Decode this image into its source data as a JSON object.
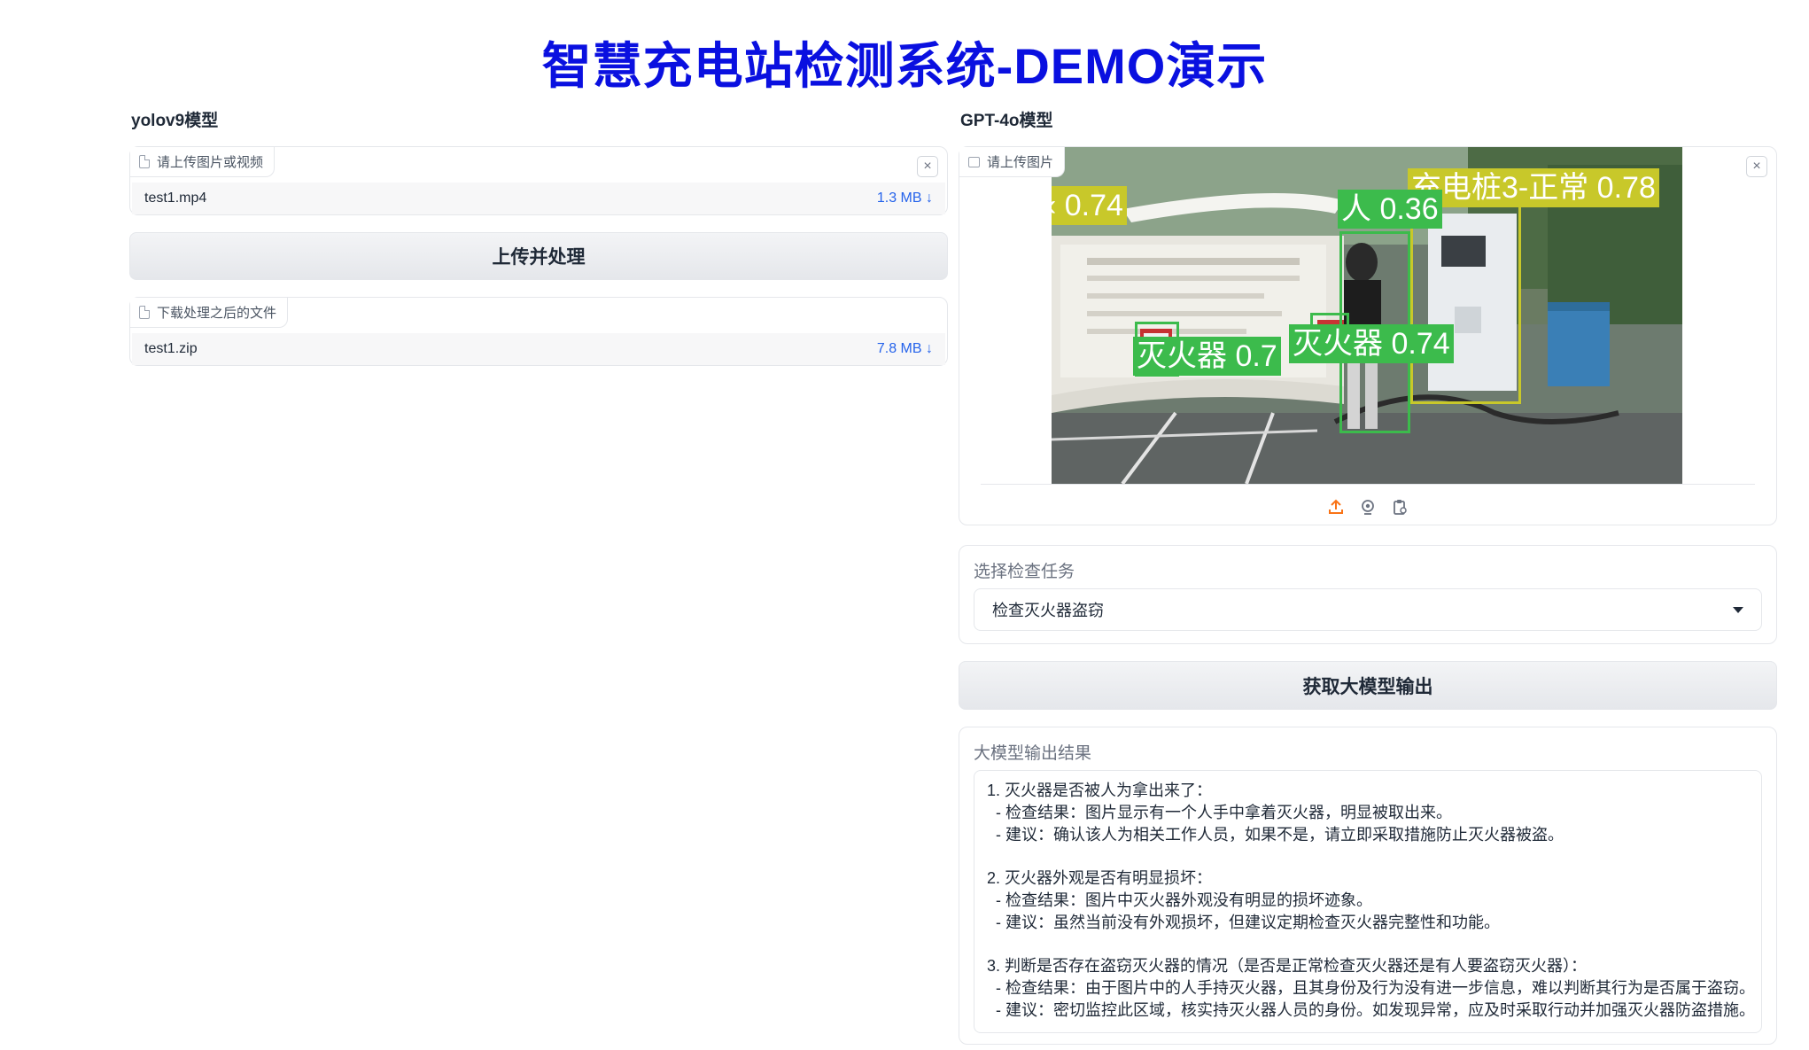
{
  "title": "智慧充电站检测系统-DEMO演示",
  "left": {
    "label": "yolov9模型",
    "upload": {
      "tag": "请上传图片或视频",
      "file_name": "test1.mp4",
      "file_size": "1.3 MB ↓"
    },
    "process_button": "上传并处理",
    "download": {
      "tag": "下载处理之后的文件",
      "file_name": "test1.zip",
      "file_size": "7.8 MB ↓"
    }
  },
  "right": {
    "label": "GPT-4o模型",
    "image_upload": {
      "tag": "请上传图片"
    },
    "detections": [
      {
        "label": "充电桩3-正常 0.78",
        "color": "#c8c82a"
      },
      {
        "label": "人 0.36",
        "color": "#3cbb4c"
      },
      {
        "label": "灭火器 0.74",
        "color": "#3cbb4c"
      },
      {
        "label": "灭火器 0.7",
        "color": "#3cbb4c"
      },
      {
        "label": "‹ 0.74",
        "color": "#c8c82a"
      }
    ],
    "task": {
      "label": "选择检查任务",
      "selected": "检查灭火器盗窃"
    },
    "get_output_button": "获取大模型输出",
    "output": {
      "label": "大模型输出结果",
      "text": "1. 灭火器是否被人为拿出来了：\n  - 检查结果：图片显示有一个人手中拿着灭火器，明显被取出来。\n  - 建议：确认该人为相关工作人员，如果不是，请立即采取措施防止灭火器被盗。\n\n2. 灭火器外观是否有明显损坏：\n  - 检查结果：图片中灭火器外观没有明显的损坏迹象。\n  - 建议：虽然当前没有外观损坏，但建议定期检查灭火器完整性和功能。\n\n3. 判断是否存在盗窃灭火器的情况（是否是正常检查灭火器还是有人要盗窃灭火器）：\n  - 检查结果：由于图片中的人手持灭火器，且其身份及行为没有进一步信息，难以判断其行为是否属于盗窃。\n  - 建议：密切监控此区域，核实持灭火器人员的身份。如发现异常，应及时采取行动并加强灭火器防盗措施。"
    }
  },
  "colors": {
    "title": "#0a10e0",
    "link": "#2563eb",
    "upload_icon": "#f97316"
  }
}
